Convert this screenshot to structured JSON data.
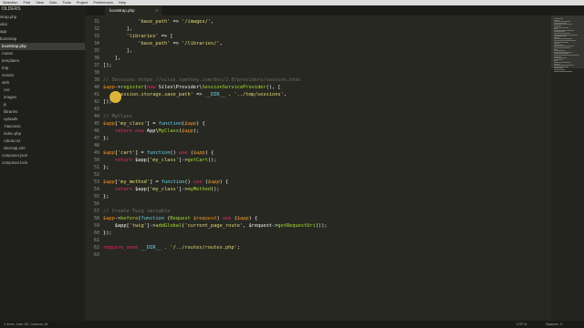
{
  "menu": [
    "Selection",
    "Find",
    "View",
    "Goto",
    "Tools",
    "Project",
    "Preferences",
    "Help"
  ],
  "sidebar": {
    "header": "OLDERS",
    "items": [
      "strap.php",
      "ulex",
      "app",
      "bootstrap",
      "bootstrap.php",
      "routes",
      "templates",
      "tmp",
      "vendor",
      "web",
      "css",
      "images",
      "js",
      "libraries",
      "uploads",
      ".htaccess",
      "index.php",
      "robots.txt",
      "sitemap.xml",
      "composer.json",
      "composer.lock"
    ],
    "active_index": 4
  },
  "tab": {
    "label": "bootstrap.php",
    "close": "×"
  },
  "lines": [
    {
      "n": "31",
      "parts": [
        [
          "p",
          "            "
        ],
        [
          "s",
          "'base_path'"
        ],
        [
          "p",
          " => "
        ],
        [
          "s",
          "'/images/'"
        ],
        [
          "p",
          ","
        ]
      ]
    },
    {
      "n": "32",
      "parts": [
        [
          "p",
          "        ],"
        ]
      ]
    },
    {
      "n": "33",
      "parts": [
        [
          "p",
          "        "
        ],
        [
          "s",
          "'libraries'"
        ],
        [
          "p",
          " => ["
        ]
      ]
    },
    {
      "n": "34",
      "parts": [
        [
          "p",
          "            "
        ],
        [
          "s",
          "'base_path'"
        ],
        [
          "p",
          " => "
        ],
        [
          "s",
          "'/libraries/'"
        ],
        [
          "p",
          ","
        ]
      ]
    },
    {
      "n": "35",
      "parts": [
        [
          "p",
          "        ],"
        ]
      ]
    },
    {
      "n": "36",
      "parts": [
        [
          "p",
          "    ],"
        ]
      ]
    },
    {
      "n": "37",
      "parts": [
        [
          "p",
          "]);"
        ]
      ]
    },
    {
      "n": "38",
      "parts": []
    },
    {
      "n": "39",
      "parts": [
        [
          "c",
          "// Sessions https://silex.symfony.com/doc/2.0/providers/session.html"
        ]
      ]
    },
    {
      "n": "40",
      "parts": [
        [
          "v",
          "$app"
        ],
        [
          "p",
          "->"
        ],
        [
          "f",
          "register"
        ],
        [
          "p",
          "("
        ],
        [
          "k",
          "new"
        ],
        [
          "p",
          " Silex\\Provider\\"
        ],
        [
          "f",
          "SessionServiceProvider"
        ],
        [
          "p",
          "(), ["
        ]
      ]
    },
    {
      "n": "41",
      "parts": [
        [
          "p",
          "    "
        ],
        [
          "s",
          "'session.storage.save_path'"
        ],
        [
          "p",
          " => "
        ],
        [
          "t",
          "__DIR__"
        ],
        [
          "p",
          " . "
        ],
        [
          "s",
          "'../tmp/sessions'"
        ],
        [
          "p",
          ","
        ]
      ]
    },
    {
      "n": "42",
      "parts": [
        [
          "p",
          "]);"
        ]
      ]
    },
    {
      "n": "43",
      "parts": []
    },
    {
      "n": "44",
      "parts": [
        [
          "c",
          "// MyClass"
        ]
      ]
    },
    {
      "n": "45",
      "parts": [
        [
          "v",
          "$app"
        ],
        [
          "p",
          "["
        ],
        [
          "s",
          "'my_class'"
        ],
        [
          "p",
          "] = "
        ],
        [
          "t",
          "function"
        ],
        [
          "p",
          "("
        ],
        [
          "v",
          "$app"
        ],
        [
          "p",
          ") {"
        ]
      ]
    },
    {
      "n": "46",
      "parts": [
        [
          "p",
          "    "
        ],
        [
          "k",
          "return"
        ],
        [
          "p",
          " "
        ],
        [
          "k",
          "new"
        ],
        [
          "p",
          " App\\"
        ],
        [
          "f",
          "MyClass"
        ],
        [
          "p",
          "("
        ],
        [
          "v",
          "$app"
        ],
        [
          "p",
          ");"
        ]
      ]
    },
    {
      "n": "47",
      "parts": [
        [
          "p",
          "};"
        ]
      ]
    },
    {
      "n": "48",
      "parts": []
    },
    {
      "n": "49",
      "parts": [
        [
          "v",
          "$app"
        ],
        [
          "p",
          "["
        ],
        [
          "s",
          "'cart'"
        ],
        [
          "p",
          "] = "
        ],
        [
          "t",
          "function"
        ],
        [
          "p",
          "() "
        ],
        [
          "k",
          "use"
        ],
        [
          "p",
          " ("
        ],
        [
          "v",
          "$app"
        ],
        [
          "p",
          ") {"
        ]
      ]
    },
    {
      "n": "50",
      "parts": [
        [
          "p",
          "    "
        ],
        [
          "k",
          "return"
        ],
        [
          "p",
          " $app["
        ],
        [
          "s",
          "'my_class'"
        ],
        [
          "p",
          "]->"
        ],
        [
          "f",
          "getCart"
        ],
        [
          "p",
          "();"
        ]
      ]
    },
    {
      "n": "51",
      "parts": [
        [
          "p",
          "};"
        ]
      ]
    },
    {
      "n": "52",
      "parts": []
    },
    {
      "n": "53",
      "parts": [
        [
          "v",
          "$app"
        ],
        [
          "p",
          "["
        ],
        [
          "s",
          "'my_method'"
        ],
        [
          "p",
          "] = "
        ],
        [
          "t",
          "function"
        ],
        [
          "p",
          "() "
        ],
        [
          "k",
          "use"
        ],
        [
          "p",
          " ("
        ],
        [
          "v",
          "$app"
        ],
        [
          "p",
          ") {"
        ]
      ]
    },
    {
      "n": "54",
      "parts": [
        [
          "p",
          "    "
        ],
        [
          "k",
          "return"
        ],
        [
          "p",
          " $app["
        ],
        [
          "s",
          "'my_class'"
        ],
        [
          "p",
          "]->"
        ],
        [
          "f",
          "myMethod"
        ],
        [
          "p",
          "();"
        ]
      ]
    },
    {
      "n": "55",
      "parts": [
        [
          "p",
          "};"
        ]
      ]
    },
    {
      "n": "56",
      "parts": []
    },
    {
      "n": "57",
      "parts": [
        [
          "c",
          "// Create Twig variable"
        ]
      ]
    },
    {
      "n": "58",
      "parts": [
        [
          "v",
          "$app"
        ],
        [
          "p",
          "->"
        ],
        [
          "f",
          "before"
        ],
        [
          "p",
          "("
        ],
        [
          "t",
          "function"
        ],
        [
          "p",
          " ("
        ],
        [
          "f",
          "Request"
        ],
        [
          "p",
          " "
        ],
        [
          "v",
          "$request"
        ],
        [
          "p",
          ") "
        ],
        [
          "k",
          "use"
        ],
        [
          "p",
          " ("
        ],
        [
          "v",
          "$app"
        ],
        [
          "p",
          ") {"
        ]
      ]
    },
    {
      "n": "59",
      "parts": [
        [
          "p",
          "    $app["
        ],
        [
          "s",
          "'twig'"
        ],
        [
          "p",
          "]->"
        ],
        [
          "f",
          "addGlobal"
        ],
        [
          "p",
          "("
        ],
        [
          "s",
          "'current_page_route'"
        ],
        [
          "p",
          ", $request->"
        ],
        [
          "f",
          "getRequestUri"
        ],
        [
          "p",
          "());"
        ]
      ]
    },
    {
      "n": "60",
      "parts": [
        [
          "p",
          "});"
        ]
      ]
    },
    {
      "n": "61",
      "parts": []
    },
    {
      "n": "62",
      "parts": [
        [
          "k",
          "require_once"
        ],
        [
          "p",
          " "
        ],
        [
          "t",
          "__DIR__"
        ],
        [
          "p",
          " . "
        ],
        [
          "s",
          "'/../routes/routes.php'"
        ],
        [
          "p",
          ";"
        ]
      ]
    },
    {
      "n": "63",
      "parts": []
    }
  ],
  "status": {
    "left": "1 error, Line 33, Column 14",
    "encoding": "UTF-8",
    "spaces": "Spaces: 4"
  },
  "colors": {
    "background": "#272822",
    "keyword": "#f92672",
    "string": "#e6db74",
    "variable": "#fd971f",
    "function": "#a6e22e",
    "comment": "#75715e",
    "type": "#66d9ef",
    "cursor_highlight": "#f1c33c"
  }
}
